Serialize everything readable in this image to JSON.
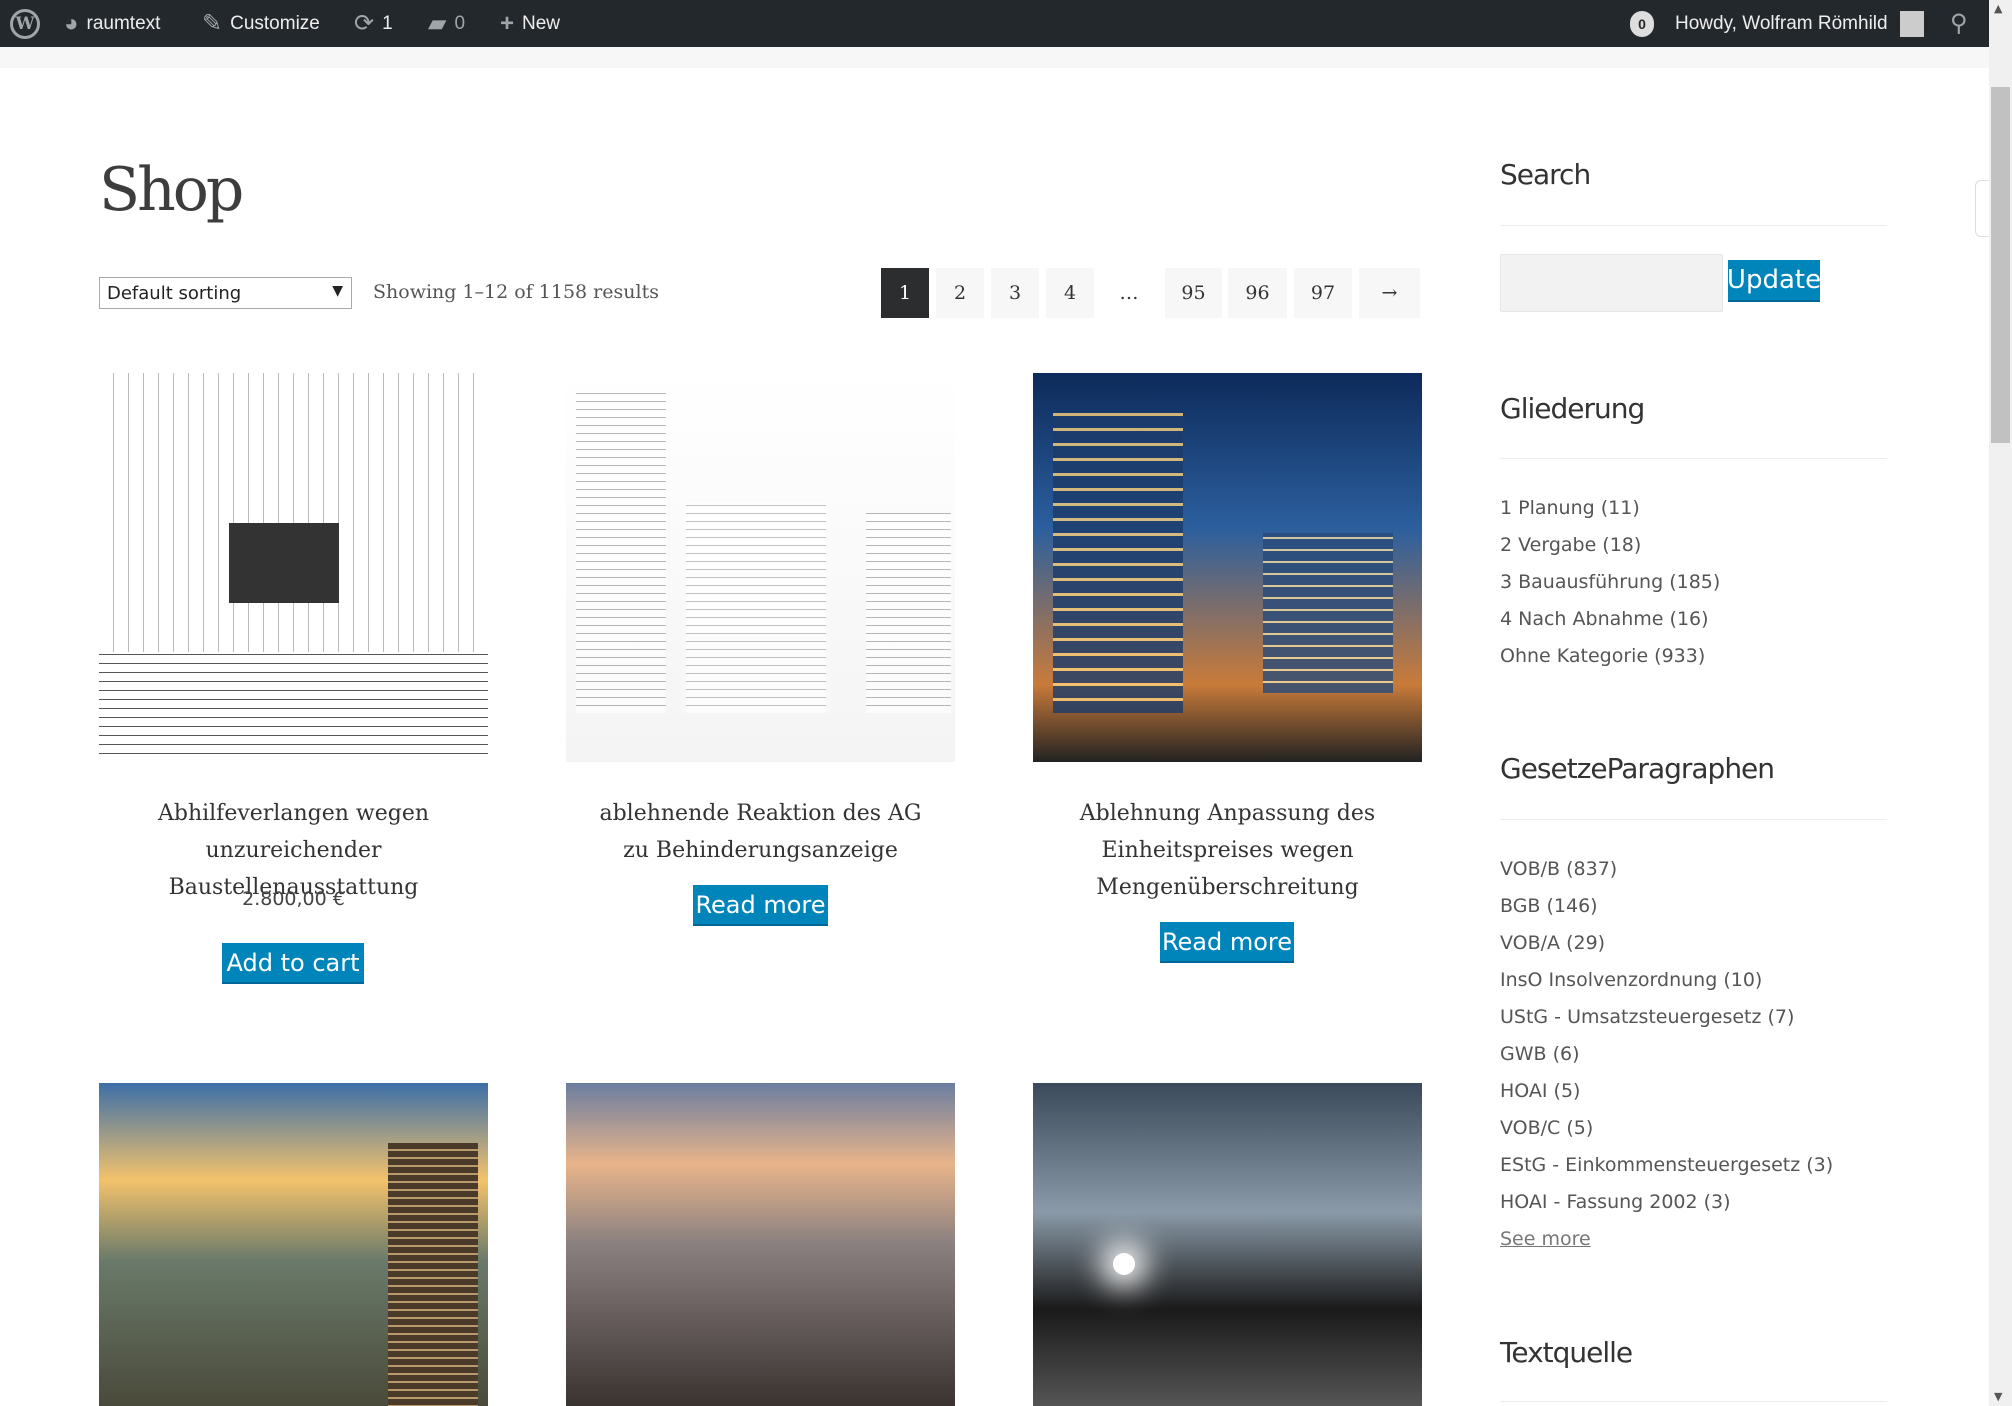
{
  "adminbar": {
    "site": "raumtext",
    "customize": "Customize",
    "updates": "1",
    "comments": "0",
    "new": "New",
    "notifications": "0",
    "howdy": "Howdy, Wolfram Römhild"
  },
  "page": {
    "title": "Shop",
    "sorting": "Default sorting",
    "showing": "Showing 1–12 of 1158 results"
  },
  "pagination": [
    "1",
    "2",
    "3",
    "4",
    "…",
    "95",
    "96",
    "97",
    "→"
  ],
  "products": [
    {
      "title": "Abhilfeverlangen wegen unzureichender Baustellenausstattung",
      "price": "2.800,00 €",
      "button": "Add to cart"
    },
    {
      "title": "ablehnende Reaktion des AG zu Behinderungsanzeige",
      "button": "Read more"
    },
    {
      "title": "Ablehnung Anpassung des Einheitspreises wegen Mengenüberschreitung",
      "button": "Read more"
    }
  ],
  "sidebar": {
    "search": {
      "title": "Search",
      "button": "Update",
      "value": ""
    },
    "gliederung": {
      "title": "Gliederung",
      "items": [
        "1 Planung (11)",
        "2 Vergabe (18)",
        "3 Bauausführung (185)",
        "4 Nach Abnahme (16)",
        "Ohne Kategorie (933)"
      ]
    },
    "gesetze": {
      "title": "GesetzeParagraphen",
      "items": [
        "VOB/B (837)",
        "BGB (146)",
        "VOB/A (29)",
        "InsO Insolvenzordnung (10)",
        "UStG - Umsatzsteuergesetz (7)",
        "GWB (6)",
        "HOAI (5)",
        "VOB/C (5)",
        "EStG - Einkommensteuergesetz (3)",
        "HOAI - Fassung 2002 (3)"
      ],
      "see_more": "See more"
    },
    "textquelle": {
      "title": "Textquelle"
    }
  }
}
